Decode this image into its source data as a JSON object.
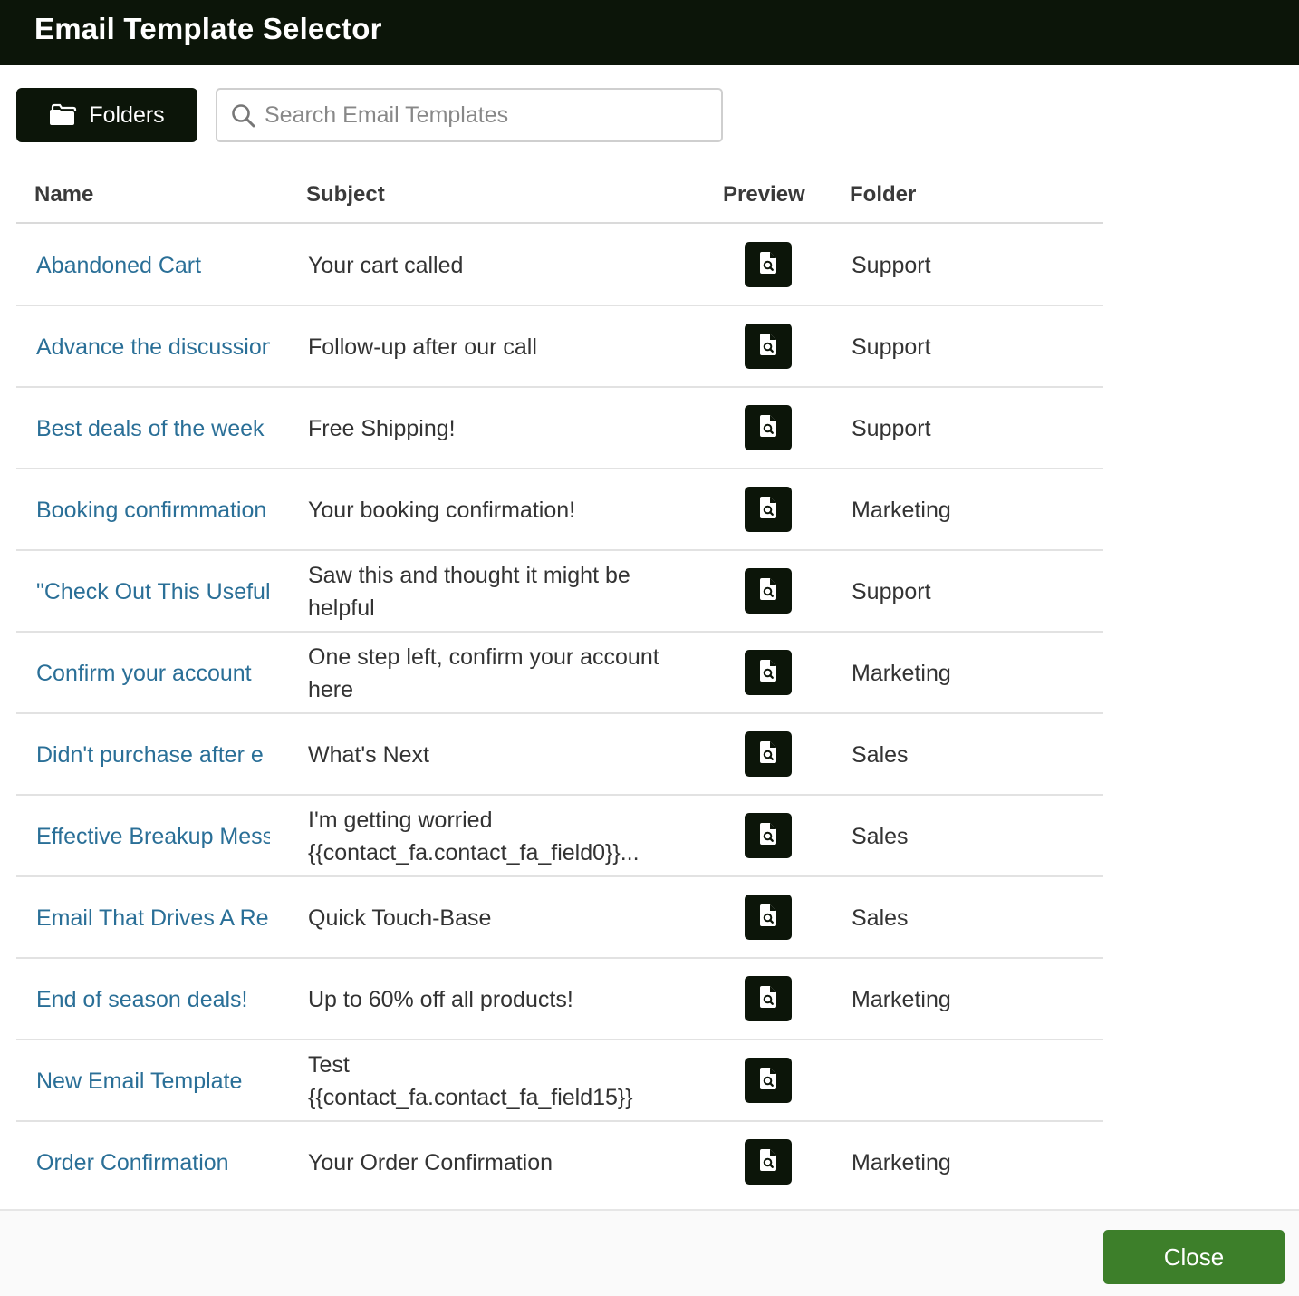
{
  "dialog": {
    "title": "Email Template Selector"
  },
  "toolbar": {
    "folders_label": "Folders",
    "search_placeholder": "Search Email Templates",
    "search_value": ""
  },
  "table": {
    "headers": {
      "name": "Name",
      "subject": "Subject",
      "preview": "Preview",
      "folder": "Folder"
    },
    "rows": [
      {
        "name": "Abandoned Cart",
        "subject": "Your cart called",
        "folder": "Support"
      },
      {
        "name": "Advance the discussion",
        "subject": "Follow-up after our call",
        "folder": "Support"
      },
      {
        "name": "Best deals of the week",
        "subject": "Free Shipping!",
        "folder": "Support"
      },
      {
        "name": "Booking confirmmation",
        "subject": "Your booking confirmation!",
        "folder": "Marketing"
      },
      {
        "name": "\"Check Out This Useful",
        "subject": "Saw this and thought it might be helpful",
        "folder": "Support"
      },
      {
        "name": "Confirm your account",
        "subject": "One step left, confirm your account here",
        "folder": "Marketing"
      },
      {
        "name": "Didn't purchase after e",
        "subject": "What's Next",
        "folder": "Sales"
      },
      {
        "name": "Effective Breakup Mess",
        "subject": "I'm getting worried {{contact_fa.contact_fa_field0}}...",
        "folder": "Sales"
      },
      {
        "name": "Email That Drives A Re",
        "subject": "Quick Touch-Base",
        "folder": "Sales"
      },
      {
        "name": "End of season deals!",
        "subject": "Up to 60% off all products!",
        "folder": "Marketing"
      },
      {
        "name": "New Email Template",
        "subject": "Test {{contact_fa.contact_fa_field15}}",
        "folder": ""
      },
      {
        "name": "Order Confirmation",
        "subject": "Your Order Confirmation",
        "folder": "Marketing"
      }
    ],
    "preview_icon": "file-search-icon"
  },
  "footer": {
    "close_label": "Close"
  },
  "colors": {
    "header_bg": "#0c1509",
    "link": "#2a6f97",
    "close_button": "#3d7f2a"
  }
}
